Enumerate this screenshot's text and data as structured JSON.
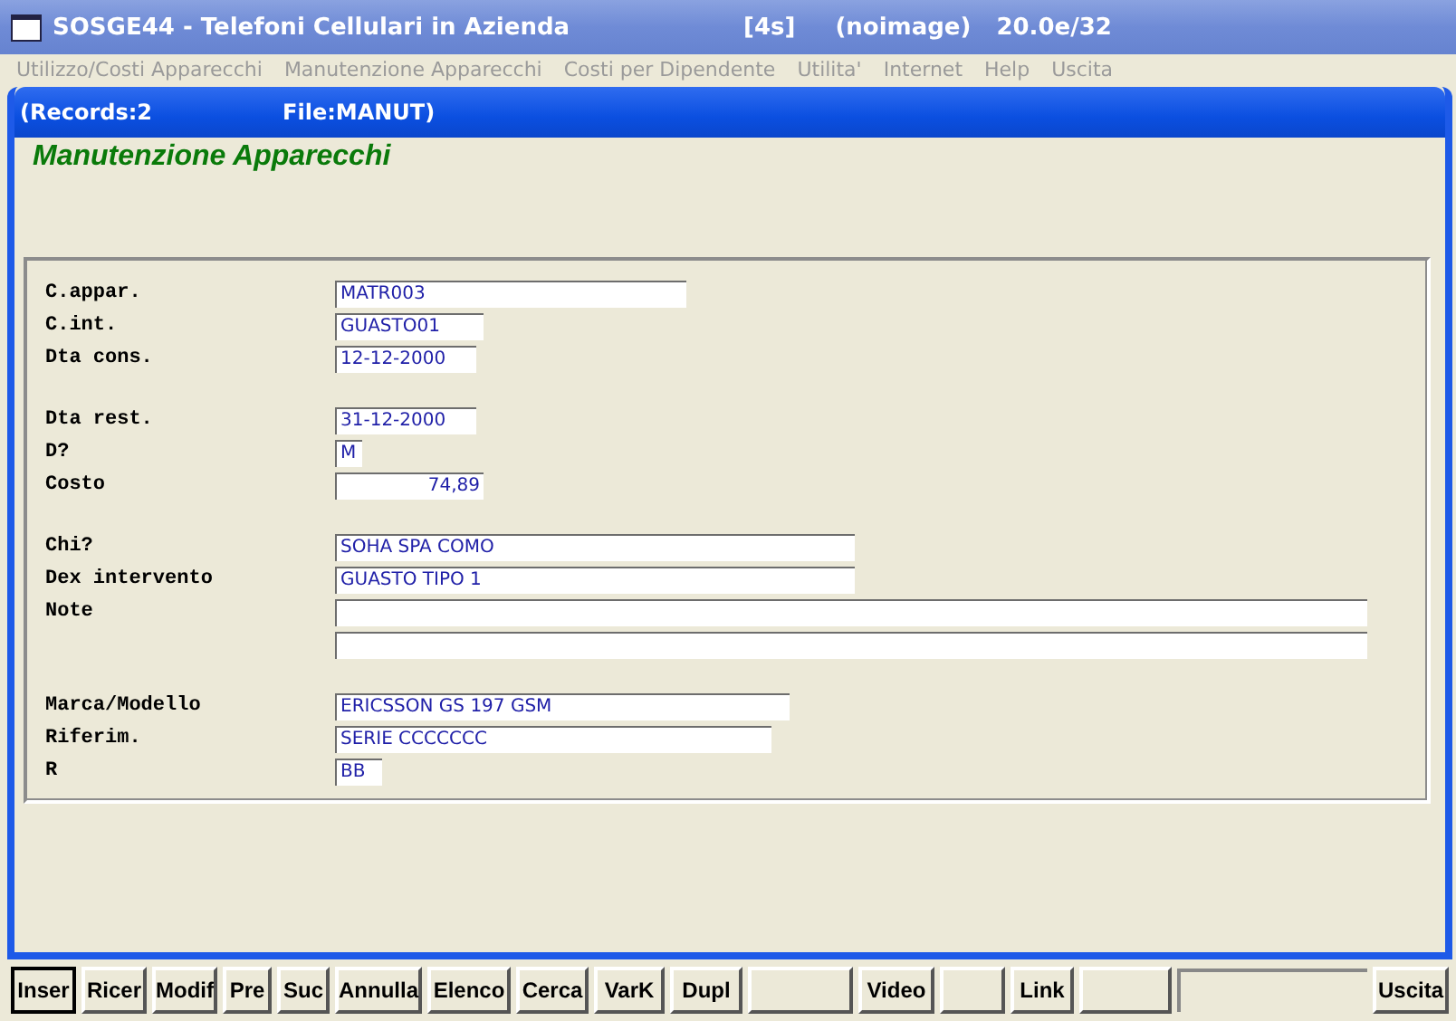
{
  "window": {
    "title": "SOSGE44 - Telefoni Cellulari in Azienda",
    "info": [
      "[4s]",
      "(noimage)",
      "20.0e/32"
    ]
  },
  "menu": [
    {
      "label": "Utilizzo/Costi Apparecchi",
      "disabled": true
    },
    {
      "label": "Manutenzione Apparecchi",
      "disabled": true
    },
    {
      "label": "Costi per Dipendente",
      "disabled": true
    },
    {
      "label": "Utilita'",
      "disabled": true
    },
    {
      "label": "Internet",
      "disabled": true
    },
    {
      "label": "Help",
      "disabled": true
    },
    {
      "label": "Uscita",
      "disabled": true
    }
  ],
  "inner_window": {
    "records": "(Records:2",
    "file": "File:MANUT)",
    "heading": "Manutenzione Apparecchi"
  },
  "form_groups": [
    [
      {
        "label": "C.appar.",
        "value": "MATR003",
        "kind": "text"
      },
      {
        "label": "C.int.",
        "value": "GUASTO01",
        "kind": "text"
      },
      {
        "label": "Dta cons.",
        "value": "12-12-2000",
        "kind": "text"
      }
    ],
    [
      {
        "label": "Dta rest.",
        "value": "31-12-2000",
        "kind": "text"
      },
      {
        "label": "D?",
        "value": "M",
        "kind": "text"
      },
      {
        "label": "Costo",
        "value": "74,89",
        "kind": "number"
      }
    ],
    [
      {
        "label": "Chi?",
        "value": "SOHA SPA COMO",
        "kind": "text"
      },
      {
        "label": "Dex intervento",
        "value": "GUASTO TIPO 1",
        "kind": "text"
      },
      {
        "label": "Note",
        "kind": "text"
      },
      {
        "kind": "text"
      }
    ],
    [
      {
        "label": "Marca/Modello",
        "value": "ERICSSON GS 197 GSM",
        "kind": "text"
      },
      {
        "label": "Riferim.",
        "value": "SERIE CCCCCCC",
        "kind": "text"
      },
      {
        "label": "R",
        "value": "BB",
        "kind": "text"
      }
    ]
  ],
  "buttons": [
    {
      "kind": "button",
      "label": "Inser",
      "selected": true
    },
    {
      "kind": "button",
      "label": "Ricer",
      "selected": false
    },
    {
      "kind": "button",
      "label": "Modif",
      "selected": false
    },
    {
      "kind": "button",
      "label": "Pre",
      "selected": false
    },
    {
      "kind": "button",
      "label": "Suc",
      "selected": false
    },
    {
      "kind": "button",
      "label": "Annulla",
      "selected": false
    },
    {
      "kind": "button",
      "label": "Elenco",
      "selected": false
    },
    {
      "kind": "button",
      "label": "Cerca",
      "selected": false
    },
    {
      "kind": "button",
      "label": "VarK",
      "selected": false
    },
    {
      "kind": "button",
      "label": "Dupl",
      "selected": false
    },
    {
      "kind": "blank"
    },
    {
      "kind": "button",
      "label": "Video",
      "selected": false
    },
    {
      "kind": "blank"
    },
    {
      "kind": "button",
      "label": "Link",
      "selected": false
    },
    {
      "kind": "blank"
    },
    {
      "kind": "gap"
    },
    {
      "kind": "button",
      "label": "Uscita",
      "selected": false
    }
  ]
}
